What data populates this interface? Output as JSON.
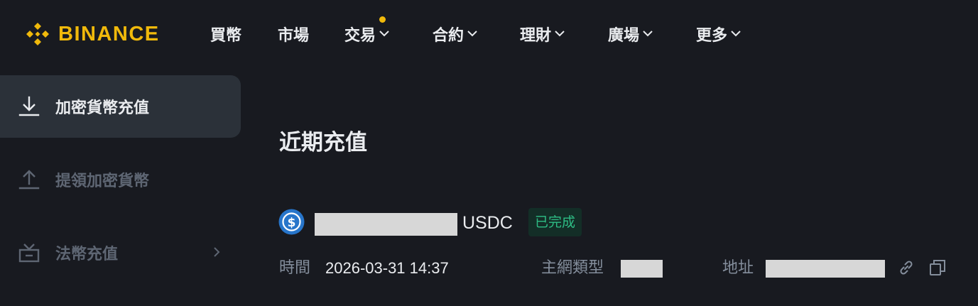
{
  "brand": {
    "name": "BINANCE",
    "color": "#f0b90b"
  },
  "nav": {
    "items": [
      {
        "label": "買幣",
        "has_dropdown": false
      },
      {
        "label": "市場",
        "has_dropdown": false
      },
      {
        "label": "交易",
        "has_dropdown": true,
        "has_notification_dot": true
      },
      {
        "label": "合約",
        "has_dropdown": true
      },
      {
        "label": "理財",
        "has_dropdown": true
      },
      {
        "label": "廣場",
        "has_dropdown": true
      },
      {
        "label": "更多",
        "has_dropdown": true
      }
    ]
  },
  "sidebar": {
    "items": [
      {
        "label": "加密貨幣充值",
        "icon": "download-icon",
        "active": true
      },
      {
        "label": "提領加密貨幣",
        "icon": "upload-icon",
        "active": false
      },
      {
        "label": "法幣充值",
        "icon": "fiat-deposit-icon",
        "active": false,
        "has_chevron": true
      }
    ]
  },
  "main": {
    "title": "近期充值",
    "record": {
      "coin_icon": "usdc-icon",
      "asset": "USDC",
      "status": "已完成",
      "status_color": "#2ebd85",
      "time_label": "時間",
      "time_value": "2026-03-31 14:37",
      "network_label": "主網類型",
      "address_label": "地址"
    }
  },
  "colors": {
    "background": "#181a20",
    "sidebar_active": "#2b3139",
    "muted_text": "#848e9c",
    "accent": "#f0b90b"
  }
}
